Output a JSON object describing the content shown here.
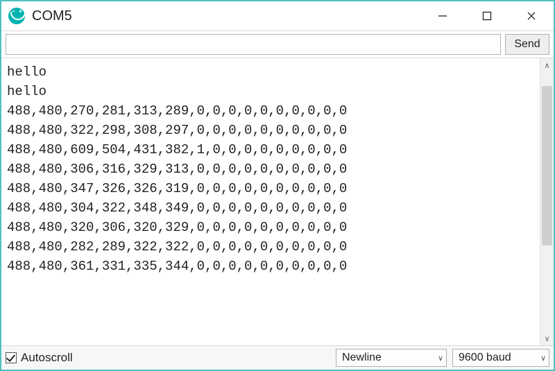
{
  "window": {
    "title": "COM5"
  },
  "toolbar": {
    "input_value": "",
    "send_label": "Send"
  },
  "output": {
    "lines": [
      "hello",
      "hello",
      "488,480,270,281,313,289,0,0,0,0,0,0,0,0,0,0",
      "488,480,322,298,308,297,0,0,0,0,0,0,0,0,0,0",
      "488,480,609,504,431,382,1,0,0,0,0,0,0,0,0,0",
      "488,480,306,316,329,313,0,0,0,0,0,0,0,0,0,0",
      "488,480,347,326,326,319,0,0,0,0,0,0,0,0,0,0",
      "488,480,304,322,348,349,0,0,0,0,0,0,0,0,0,0",
      "488,480,320,306,320,329,0,0,0,0,0,0,0,0,0,0",
      "488,480,282,289,322,322,0,0,0,0,0,0,0,0,0,0",
      "488,480,361,331,335,344,0,0,0,0,0,0,0,0,0,0"
    ]
  },
  "statusbar": {
    "autoscroll_label": "Autoscroll",
    "autoscroll_checked": true,
    "line_ending": "Newline",
    "baud_rate": "9600 baud"
  },
  "scroll": {
    "up_glyph": "∧",
    "down_glyph": "∨"
  },
  "dropdown": {
    "arrow_glyph": "∨"
  }
}
